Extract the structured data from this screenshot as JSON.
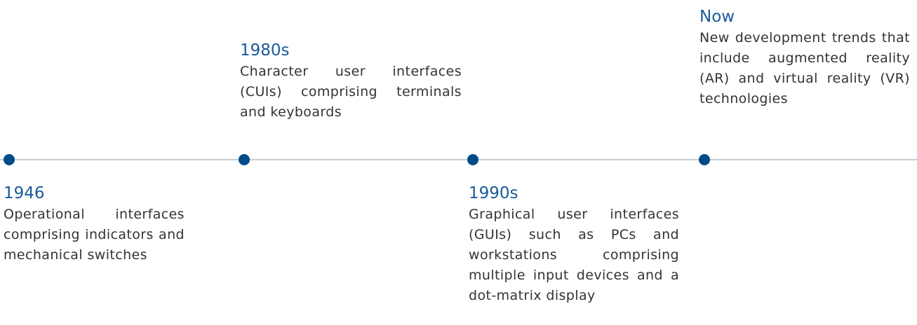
{
  "timeline": {
    "colors": {
      "accent": "#004b87",
      "year_text": "#1a5a99",
      "line": "#c8cdd3",
      "body_text": "#333333"
    },
    "events": [
      {
        "year": "1946",
        "description": "Operational interfaces comprising indicators and mechanical switches"
      },
      {
        "year": "1980s",
        "description": "Character user interfaces (CUIs) comprising terminals and keyboards"
      },
      {
        "year": "1990s",
        "description": "Graphical user interfaces (GUIs) such as PCs and workstations comprising multiple input devices and a dot-matrix display"
      },
      {
        "year": "Now",
        "description": "New development trends that include augmented reality (AR) and virtual reality (VR) technologies"
      }
    ]
  }
}
